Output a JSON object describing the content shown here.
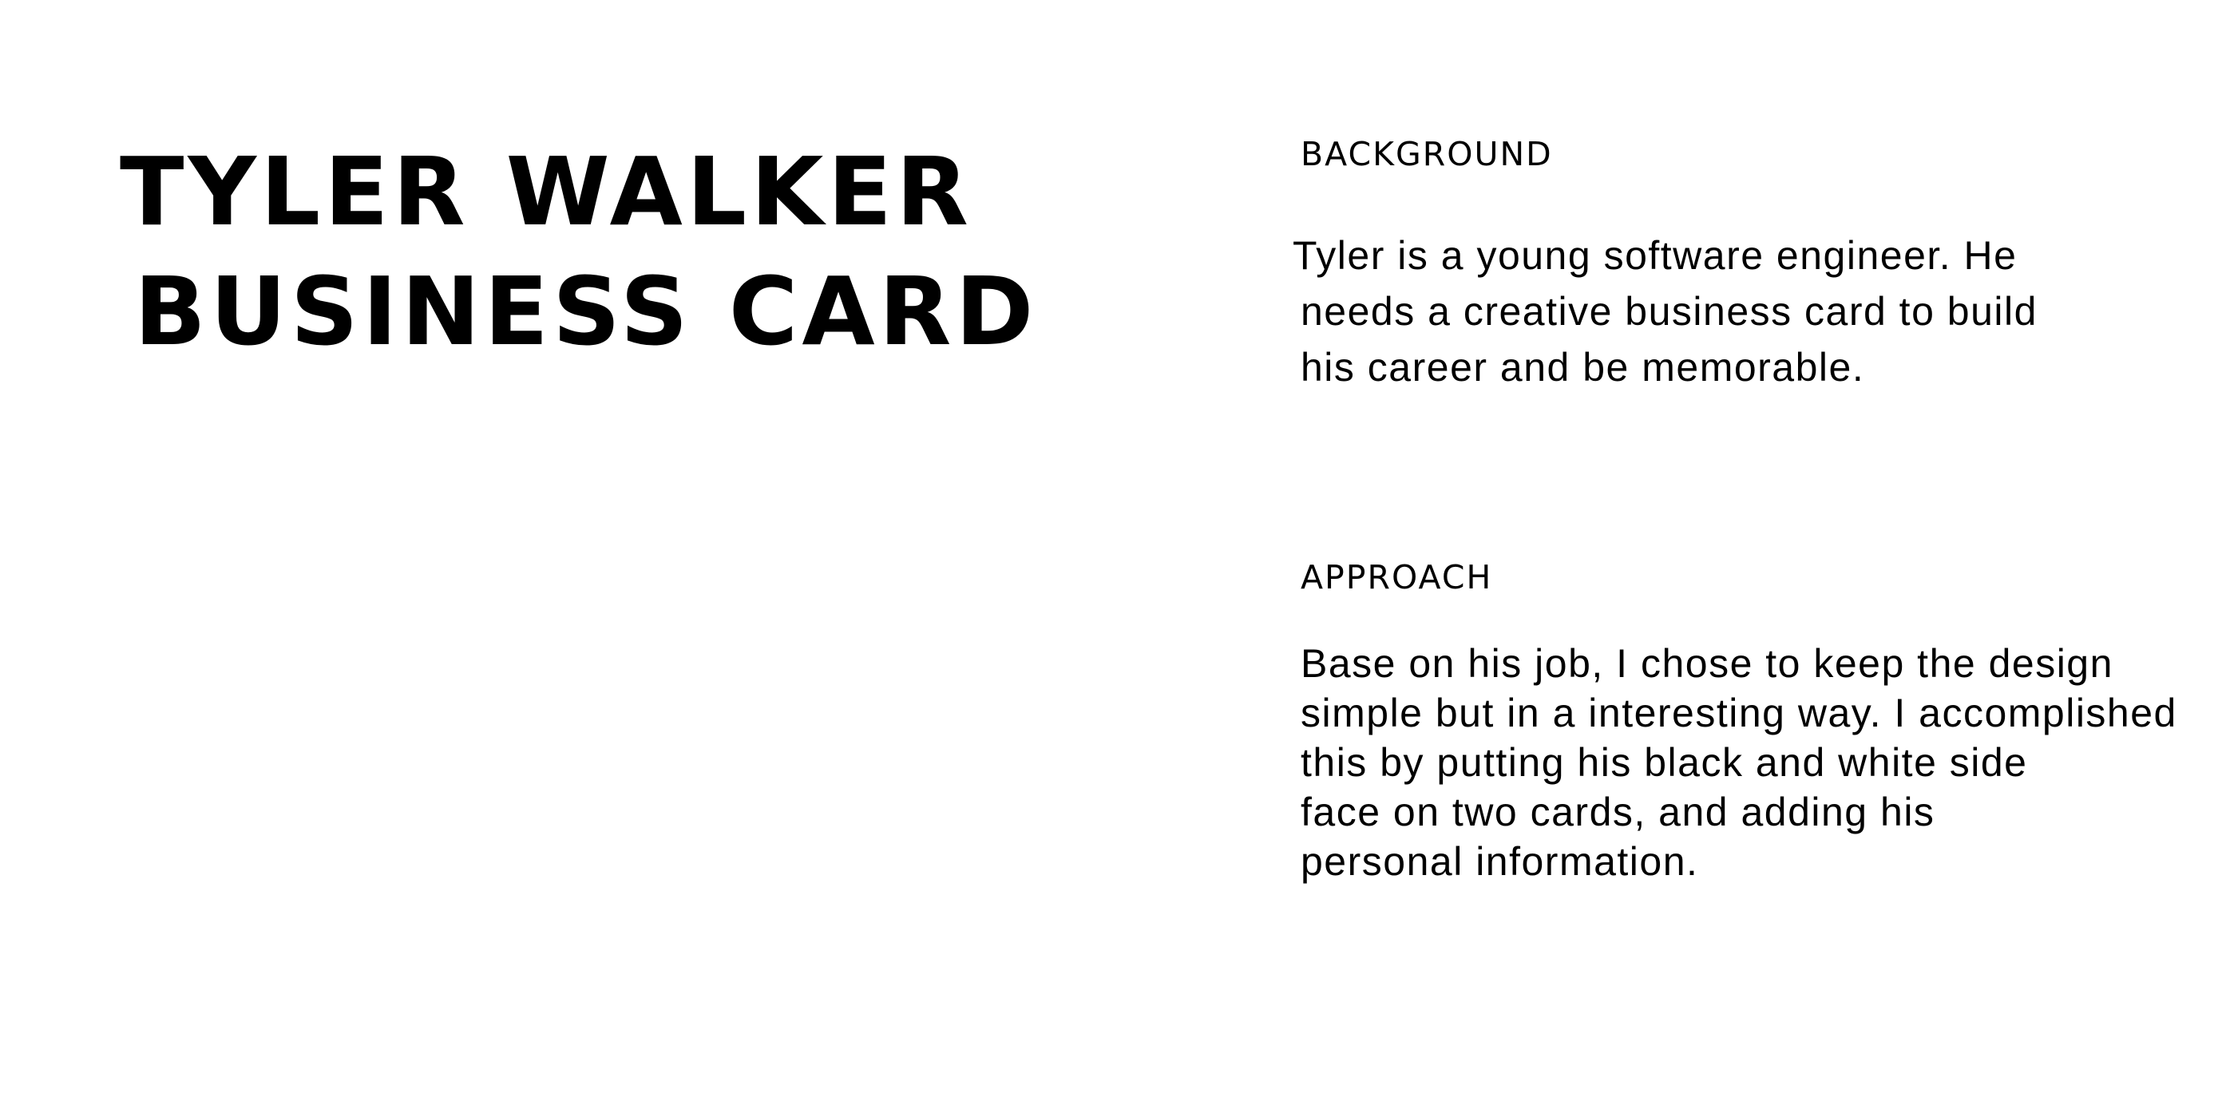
{
  "title": {
    "line1": "TYLER WALKER",
    "line2": "BUSINESS CARD"
  },
  "background": {
    "heading": "BACKGROUND",
    "lines": [
      "Tyler is a young software engineer. He",
      "needs a creative business card to build",
      "his career and be memorable."
    ]
  },
  "approach": {
    "heading": "APPROACH",
    "lines": [
      "Base on his job, I chose to keep the design",
      "simple but in a interesting way. I accomplished",
      "this by putting his black and white side",
      "face on two cards, and adding his",
      "personal information."
    ]
  }
}
